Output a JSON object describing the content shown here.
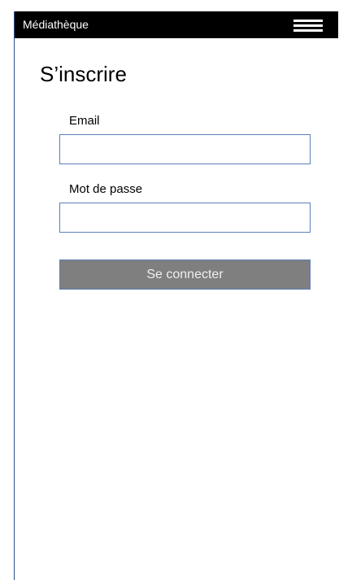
{
  "header": {
    "app_title": "Médiathèque",
    "menu_icon": "hamburger-menu-icon"
  },
  "main": {
    "page_title": "S’inscrire",
    "email": {
      "label": "Email",
      "value": "",
      "placeholder": ""
    },
    "password": {
      "label": "Mot de passe",
      "value": "",
      "placeholder": ""
    },
    "submit_label": "Se connecter"
  },
  "colors": {
    "header_background": "#000000",
    "header_text": "#ffffff",
    "button_background": "#7f7f7f",
    "button_text": "#f0f0f0",
    "field_border": "#5b7fb8",
    "frame_border": "#2c4f8a"
  }
}
